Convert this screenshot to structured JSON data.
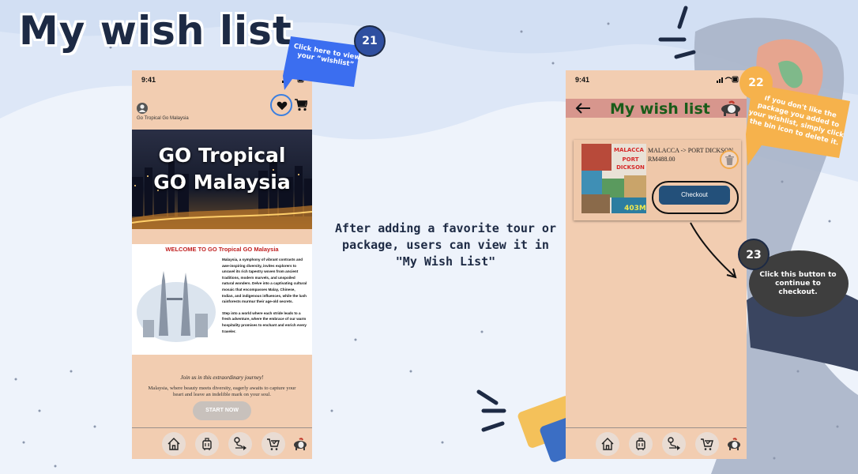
{
  "page": {
    "title": "My wish list",
    "center_note": "After adding a favorite tour or package, users can view it in \"My Wish List\""
  },
  "callouts": {
    "c21": {
      "number": "21",
      "text": "Click here to view your “wishlist”"
    },
    "c22": {
      "number": "22",
      "text": "If you don't like the package you added to your wishlist, simply click the bin icon to delete it."
    },
    "c23": {
      "number": "23",
      "text": "Click this button to continue to checkout."
    }
  },
  "left_phone": {
    "status_time": "9:41",
    "brand": "Go Tropical Go Malaysia",
    "hero_line1": "GO Tropical",
    "hero_line2": "GO Malaysia",
    "welcome_title": "WELCOME TO GO Tropical GO Malaysia",
    "welcome_p1": "Malaysia, a symphony of vibrant contrasts and awe-inspiring diversity, invites explorers to unravel its rich tapestry woven from ancient traditions, modern marvels, and unspoiled natural wonders. Delve into a captivating cultural mosaic that encompasses Malay, Chinese, Indian, and indigenous influences, while the lush rainforests murmur their age-old secrets.",
    "welcome_p2": "Step into a world where each stride leads to a fresh adventure, where the embrace of our warm hospitality promises to enchant and enrich every traveler.",
    "join_title": "Join us in this extraordinary journey!",
    "join_desc": "Malaysia, where beauty meets diversity, eagerly awaits to capture your heart and leave an indelible mark on your soul.",
    "start_button": "START NOW",
    "icons": {
      "wishlist": "heart-icon",
      "cart": "cart-icon"
    }
  },
  "right_phone": {
    "status_time": "9:41",
    "header_title": "My wish list",
    "item": {
      "name": "MALACCA -> PORT DICKSON",
      "price": "RM488.00",
      "thumb_lines": [
        "MALACCA",
        "PORT",
        "DICKSON"
      ],
      "thumb_price": "403M"
    },
    "checkout_button": "Checkout"
  },
  "tabbar": [
    "home-icon",
    "luggage-icon",
    "route-icon",
    "cart-check-icon",
    "tapir-mascot-icon"
  ],
  "colors": {
    "phone_bg": "#f2cdb1",
    "header_pink": "#d7968d",
    "title_green": "#1a5c1a",
    "checkout_blue": "#23507a",
    "callout_blue": "#3b6ef0",
    "callout_orange": "#f6b24c",
    "callout_dark": "#3e3e3e"
  }
}
